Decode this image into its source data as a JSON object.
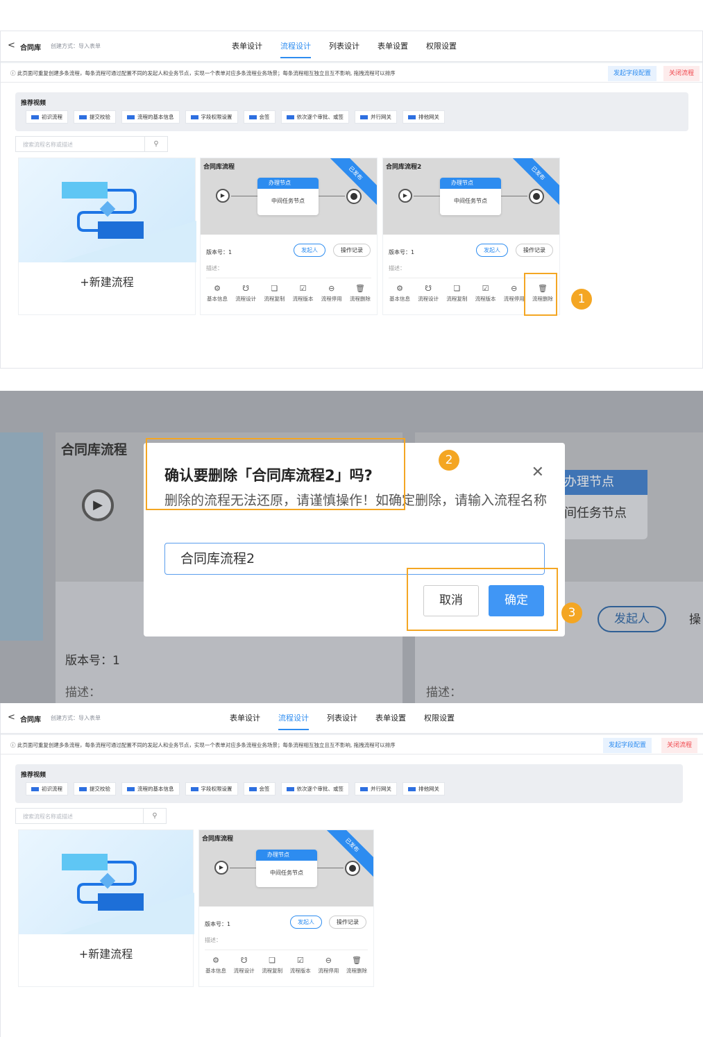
{
  "header": {
    "back": "<",
    "app_name": "合同库",
    "create_mode": "创建方式：导入表单",
    "tabs": [
      "表单设计",
      "流程设计",
      "列表设计",
      "表单设置",
      "权限设置"
    ],
    "active_tab": "流程设计"
  },
  "notice": {
    "text": "此页面可重复创建多条流程，每条流程可通过配置不同的发起人和业务节点，实现一个表单对应多条流程业务场景；每条流程相互独立且互不影响, 拖拽流程可以排序",
    "field_config_button": "发起字段配置",
    "close_flow_button": "关闭流程"
  },
  "videos": {
    "title": "推荐视频",
    "items": [
      "初识流程",
      "提交校验",
      "流程的基本信息",
      "字段权限设置",
      "会签",
      "依次逐个审批、或签",
      "并行网关",
      "排他网关"
    ]
  },
  "search": {
    "placeholder": "搜索流程名称或描述"
  },
  "new_flow_label": "+新建流程",
  "flow_card": {
    "status": "已发布",
    "node_header": "办理节点",
    "node_body": "中间任务节点",
    "version": "版本号：1",
    "desc": "描述：",
    "initiator_button": "发起人",
    "log_button": "操作记录",
    "actions": [
      "基本信息",
      "流程设计",
      "流程复制",
      "流程版本",
      "流程停用",
      "流程删除"
    ]
  },
  "flows_before": [
    {
      "title": "合同库流程"
    },
    {
      "title": "合同库流程2"
    }
  ],
  "flows_after": [
    {
      "title": "合同库流程"
    }
  ],
  "steps": [
    "1",
    "2",
    "3"
  ],
  "dialog": {
    "title": "确认要删除「合同库流程2」吗?",
    "description": "删除的流程无法还原，请谨慎操作！如确定删除，请输入流程名称",
    "input_value": "合同库流程2",
    "cancel": "取消",
    "confirm": "确定"
  },
  "background": {
    "card_title": "合同库流程",
    "version": "版本号：1",
    "desc": "描述：",
    "node_header": "办理节点",
    "node_body": "间任务节点",
    "initiator": "发起人",
    "partial_button": "操"
  },
  "colors": {
    "primary": "#2d8cf0",
    "highlight": "#f4a623",
    "danger": "#f0454b"
  }
}
